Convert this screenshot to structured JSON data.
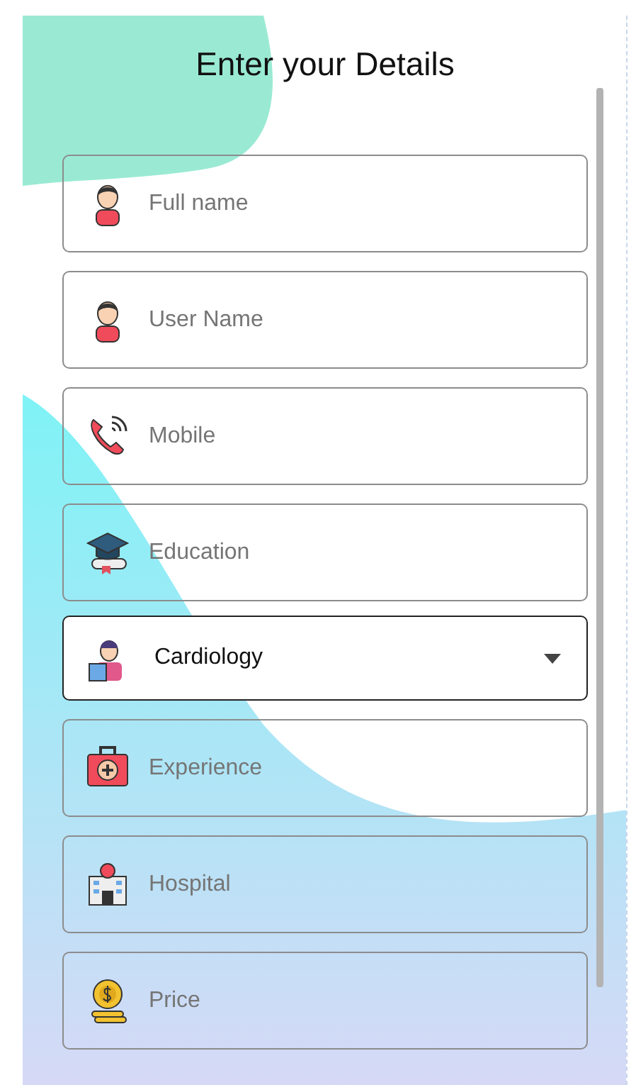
{
  "title": "Enter your Details",
  "fields": [
    {
      "kind": "text",
      "placeholder": "Full name"
    },
    {
      "kind": "text",
      "placeholder": "User Name"
    },
    {
      "kind": "text",
      "placeholder": "Mobile"
    },
    {
      "kind": "text",
      "placeholder": "Education"
    },
    {
      "kind": "select",
      "value": "Cardiology"
    },
    {
      "kind": "text",
      "placeholder": "Experience"
    },
    {
      "kind": "text",
      "placeholder": "Hospital"
    },
    {
      "kind": "text",
      "placeholder": "Price"
    }
  ]
}
